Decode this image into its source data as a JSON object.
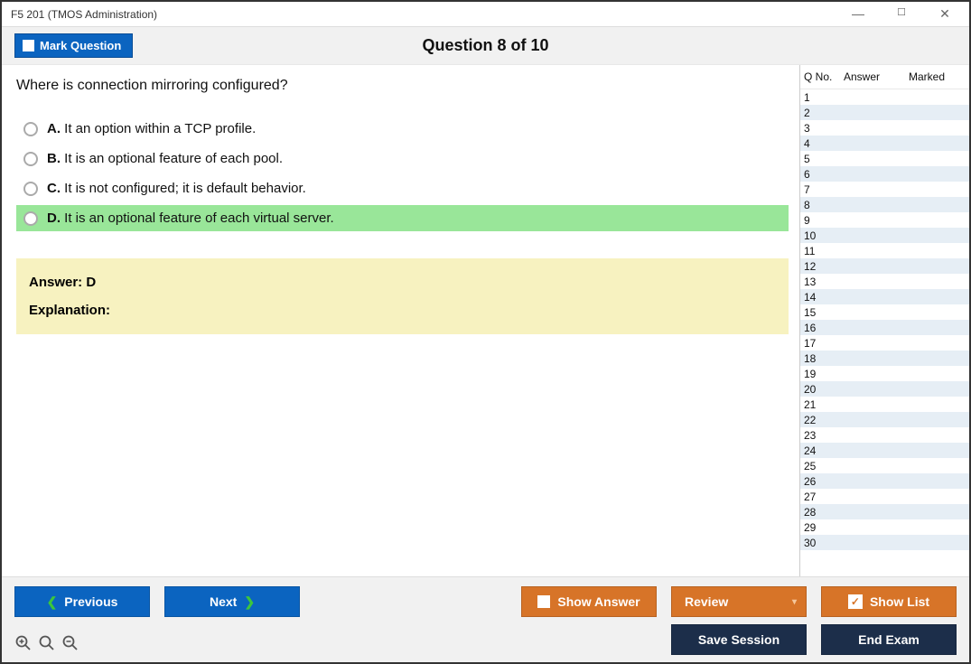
{
  "window": {
    "title": "F5 201 (TMOS Administration)"
  },
  "header": {
    "mark_label": "Mark Question",
    "question_label": "Question 8 of 10"
  },
  "question": {
    "text": "Where is connection mirroring configured?",
    "options": [
      {
        "letter": "A.",
        "text": "It an option within a TCP profile.",
        "correct": false
      },
      {
        "letter": "B.",
        "text": "It is an optional feature of each pool.",
        "correct": false
      },
      {
        "letter": "C.",
        "text": "It is not configured; it is default behavior.",
        "correct": false
      },
      {
        "letter": "D.",
        "text": "It is an optional feature of each virtual server.",
        "correct": true
      }
    ],
    "answer_label": "Answer: D",
    "explanation_label": "Explanation:"
  },
  "side": {
    "headers": {
      "qno": "Q No.",
      "answer": "Answer",
      "marked": "Marked"
    },
    "rows": [
      {
        "n": "1"
      },
      {
        "n": "2"
      },
      {
        "n": "3"
      },
      {
        "n": "4"
      },
      {
        "n": "5"
      },
      {
        "n": "6"
      },
      {
        "n": "7"
      },
      {
        "n": "8"
      },
      {
        "n": "9"
      },
      {
        "n": "10"
      },
      {
        "n": "11"
      },
      {
        "n": "12"
      },
      {
        "n": "13"
      },
      {
        "n": "14"
      },
      {
        "n": "15"
      },
      {
        "n": "16"
      },
      {
        "n": "17"
      },
      {
        "n": "18"
      },
      {
        "n": "19"
      },
      {
        "n": "20"
      },
      {
        "n": "21"
      },
      {
        "n": "22"
      },
      {
        "n": "23"
      },
      {
        "n": "24"
      },
      {
        "n": "25"
      },
      {
        "n": "26"
      },
      {
        "n": "27"
      },
      {
        "n": "28"
      },
      {
        "n": "29"
      },
      {
        "n": "30"
      }
    ]
  },
  "footer": {
    "previous": "Previous",
    "next": "Next",
    "show_answer": "Show Answer",
    "review": "Review",
    "show_list": "Show List",
    "save_session": "Save Session",
    "end_exam": "End Exam"
  }
}
